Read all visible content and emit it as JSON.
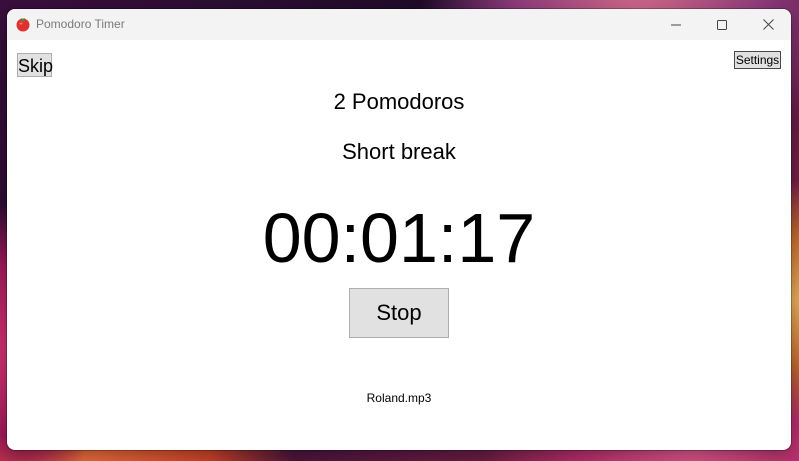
{
  "window": {
    "title": "Pomodoro Timer",
    "app_icon": "tomato-icon",
    "caption_buttons": [
      "minimize-icon",
      "maximize-icon",
      "close-icon"
    ]
  },
  "toolbar": {
    "skip_label": "Skip",
    "settings_label": "Settings"
  },
  "main": {
    "pomodoro_count": "2 Pomodoros",
    "phase": "Short break",
    "timer": "00:01:17",
    "stop_label": "Stop",
    "sound_file": "Roland.mp3"
  },
  "colors": {
    "titlebar_bg": "#f3f3f3",
    "button_bg": "#e1e1e1",
    "tomato_red": "#e0312f",
    "tomato_leaf": "#3a9b3a"
  }
}
